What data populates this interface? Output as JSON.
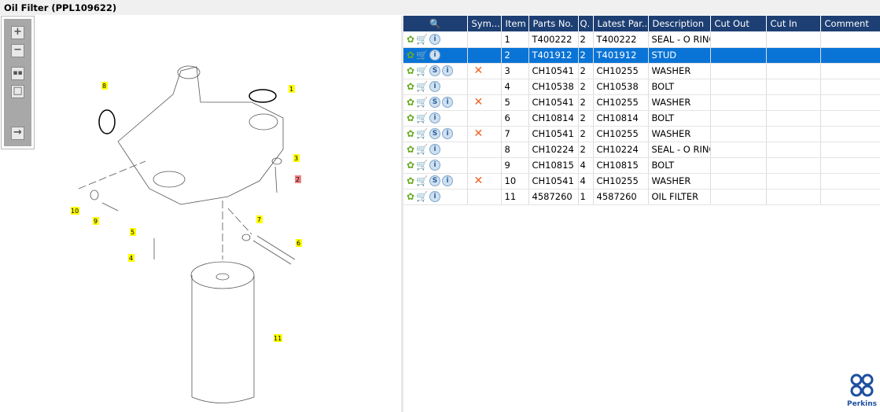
{
  "title": "Oil Filter (PPL109622)",
  "toolbar": {
    "icons": [
      "zoom-in",
      "zoom-out",
      "fit-all",
      "fit-window",
      "toggle-panel"
    ]
  },
  "callouts": [
    "8",
    "1",
    "3",
    "2",
    "10",
    "9",
    "5",
    "7",
    "6",
    "4",
    "11"
  ],
  "table": {
    "headers": [
      "Sym...",
      "Item",
      "Parts No.",
      "Q.",
      "Latest Par...",
      "Description",
      "Cut Out",
      "Cut In",
      "Comment"
    ],
    "rows": [
      {
        "s": false,
        "x": false,
        "item": "1",
        "part": "T400222",
        "q": "2",
        "latest": "T400222",
        "desc": "SEAL - O RING"
      },
      {
        "s": false,
        "x": false,
        "item": "2",
        "part": "T401912",
        "q": "2",
        "latest": "T401912",
        "desc": "STUD",
        "selected": true
      },
      {
        "s": true,
        "x": true,
        "item": "3",
        "part": "CH10541",
        "q": "2",
        "latest": "CH10255",
        "desc": "WASHER"
      },
      {
        "s": false,
        "x": false,
        "item": "4",
        "part": "CH10538",
        "q": "2",
        "latest": "CH10538",
        "desc": "BOLT"
      },
      {
        "s": true,
        "x": true,
        "item": "5",
        "part": "CH10541",
        "q": "2",
        "latest": "CH10255",
        "desc": "WASHER"
      },
      {
        "s": false,
        "x": false,
        "item": "6",
        "part": "CH10814",
        "q": "2",
        "latest": "CH10814",
        "desc": "BOLT"
      },
      {
        "s": true,
        "x": true,
        "item": "7",
        "part": "CH10541",
        "q": "2",
        "latest": "CH10255",
        "desc": "WASHER"
      },
      {
        "s": false,
        "x": false,
        "item": "8",
        "part": "CH10224",
        "q": "2",
        "latest": "CH10224",
        "desc": "SEAL - O RING"
      },
      {
        "s": false,
        "x": false,
        "item": "9",
        "part": "CH10815",
        "q": "4",
        "latest": "CH10815",
        "desc": "BOLT"
      },
      {
        "s": true,
        "x": true,
        "item": "10",
        "part": "CH10541",
        "q": "4",
        "latest": "CH10255",
        "desc": "WASHER"
      },
      {
        "s": false,
        "x": false,
        "item": "11",
        "part": "4587260",
        "q": "1",
        "latest": "4587260",
        "desc": "OIL FILTER"
      }
    ]
  },
  "logo": "Perkins",
  "colors": {
    "header": "#1d3f73",
    "selected": "#0a74d6",
    "callout": "#ffff00",
    "callout_active": "#f08080"
  }
}
